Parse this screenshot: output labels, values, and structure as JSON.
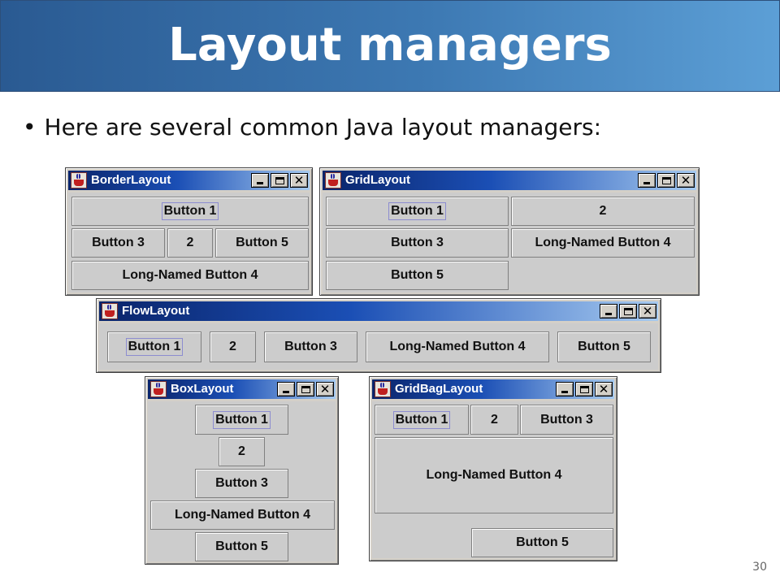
{
  "slide": {
    "title": "Layout managers",
    "bullet": "Here are several common Java layout managers:",
    "page_number": "30"
  },
  "windows": {
    "border": {
      "title": "BorderLayout",
      "buttons": [
        "Button 1",
        "Button 3",
        "2",
        "Button 5",
        "Long-Named Button 4"
      ]
    },
    "grid": {
      "title": "GridLayout",
      "buttons": [
        "Button 1",
        "2",
        "Button 3",
        "Long-Named Button 4",
        "Button 5"
      ]
    },
    "flow": {
      "title": "FlowLayout",
      "buttons": [
        "Button 1",
        "2",
        "Button 3",
        "Long-Named Button 4",
        "Button 5"
      ]
    },
    "box": {
      "title": "BoxLayout",
      "buttons": [
        "Button 1",
        "2",
        "Button 3",
        "Long-Named Button 4",
        "Button 5"
      ]
    },
    "gridbag": {
      "title": "GridBagLayout",
      "buttons": [
        "Button 1",
        "2",
        "Button 3",
        "Long-Named Button 4",
        "Button 5"
      ]
    }
  },
  "icons": {
    "window_icon": "java-coffee-cup-icon",
    "minimize": "minimize-icon",
    "maximize": "maximize-icon",
    "close": "close-icon"
  },
  "colors": {
    "title_banner": "#3d79b3",
    "titlebar_start": "#0a246a",
    "titlebar_end": "#a6caf0",
    "window_face": "#d4d0c8",
    "content_bg": "#cccccc"
  }
}
